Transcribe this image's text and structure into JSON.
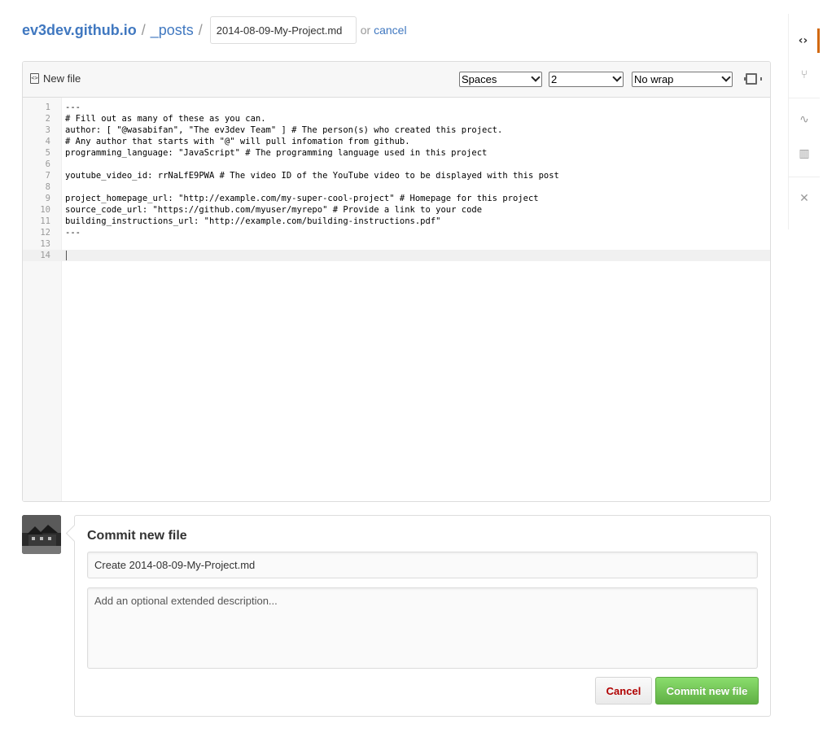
{
  "breadcrumb": {
    "repo": "ev3dev.github.io",
    "separator": "/",
    "folder": "_posts",
    "filename_value": "2014-08-09-My-Project.md",
    "or_text": "or",
    "cancel_link": "cancel"
  },
  "editor": {
    "tab_label": "New file",
    "indent_mode": "Spaces",
    "indent_size": "2",
    "wrap_mode": "No wrap",
    "lines": [
      {
        "num": "1",
        "text": "---"
      },
      {
        "num": "2",
        "text": "# Fill out as many of these as you can."
      },
      {
        "num": "3",
        "text": "author: [ \"@wasabifan\", \"The ev3dev Team\" ] # The person(s) who created this project."
      },
      {
        "num": "4",
        "text": "# Any author that starts with \"@\" will pull infomation from github."
      },
      {
        "num": "5",
        "text": "programming_language: \"JavaScript\" # The programming language used in this project"
      },
      {
        "num": "6",
        "text": ""
      },
      {
        "num": "7",
        "text": "youtube_video_id: rrNaLfE9PWA # The video ID of the YouTube video to be displayed with this post"
      },
      {
        "num": "8",
        "text": ""
      },
      {
        "num": "9",
        "text": "project_homepage_url: \"http://example.com/my-super-cool-project\" # Homepage for this project"
      },
      {
        "num": "10",
        "text": "source_code_url: \"https://github.com/myuser/myrepo\" # Provide a link to your code"
      },
      {
        "num": "11",
        "text": "building_instructions_url: \"http://example.com/building-instructions.pdf\""
      },
      {
        "num": "12",
        "text": "---"
      },
      {
        "num": "13",
        "text": ""
      },
      {
        "num": "14",
        "text": ""
      }
    ]
  },
  "sidebar": {
    "icons": [
      "code-icon",
      "pull-request-icon",
      "pulse-icon",
      "graph-icon",
      "settings-icon"
    ]
  },
  "commit": {
    "title": "Commit new file",
    "summary_value": "Create 2014-08-09-My-Project.md",
    "description_placeholder": "Add an optional extended description...",
    "cancel_label": "Cancel",
    "commit_label": "Commit new file"
  },
  "colors": {
    "link": "#4078c0",
    "accent_tab": "#d26911",
    "commit_green": "#60b044",
    "cancel_red": "#b00000"
  }
}
